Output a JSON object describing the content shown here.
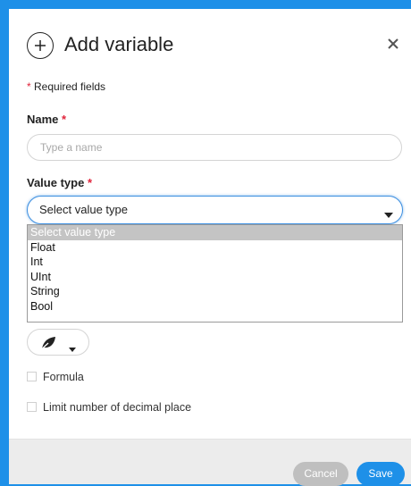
{
  "dialog": {
    "title": "Add variable",
    "required_note_star": "*",
    "required_note_text": "Required fields"
  },
  "fields": {
    "name": {
      "label": "Name",
      "required_star": "*",
      "placeholder": "Type a name",
      "value": ""
    },
    "value_type": {
      "label": "Value type",
      "required_star": "*",
      "selected": "Select value type",
      "options": [
        "Select value type",
        "Float",
        "Int",
        "UInt",
        "String",
        "Bool"
      ]
    },
    "icon_picker": {
      "icon": "leaf-icon"
    },
    "formula": {
      "label": "Formula",
      "checked": false
    },
    "limit_decimals": {
      "label": "Limit number of decimal place",
      "checked": false
    }
  },
  "footer": {
    "cancel_label": "Cancel",
    "save_label": "Save"
  },
  "colors": {
    "accent": "#1e90e8",
    "required": "#e0233a",
    "disabled_button": "#bfbfbf"
  }
}
